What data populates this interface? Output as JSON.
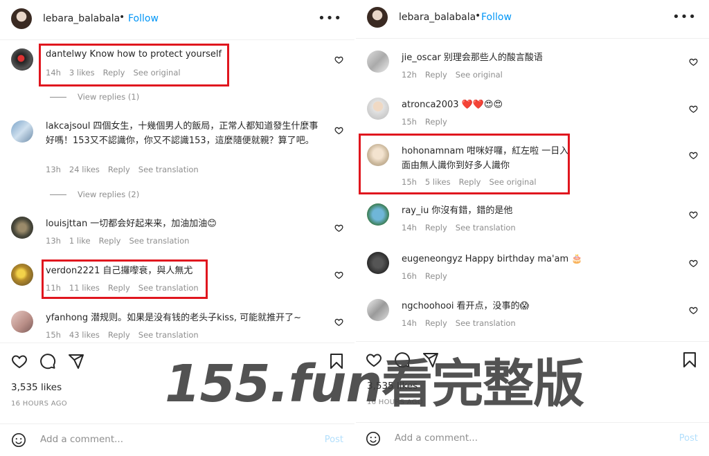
{
  "left_panel": {
    "header": {
      "username": "lebara_balabala",
      "dot": "•",
      "follow": "Follow",
      "more": "•••"
    },
    "comments": [
      {
        "username": "dantelwy",
        "text": "Know how to protect yourself",
        "time": "14h",
        "likes": "3 likes",
        "reply": "Reply",
        "link": "See original"
      },
      {
        "username": "lakcajsoul",
        "text": "四個女生，十幾個男人的飯局，正常人都知道發生什麼事好嗎！153又不認識你，你又不認識153，這麼隨便就親？算了吧。",
        "time": "13h",
        "likes": "24 likes",
        "reply": "Reply",
        "link": "See translation"
      },
      {
        "username": "louisjttan",
        "text": "一切都会好起来来，加油加油😊",
        "time": "13h",
        "likes": "1 like",
        "reply": "Reply",
        "link": "See translation"
      },
      {
        "username": "verdon2221",
        "text": "自己攞嚟衰，與人無尤",
        "time": "11h",
        "likes": "11 likes",
        "reply": "Reply",
        "link": "See translation"
      },
      {
        "username": "yfanhong",
        "text": "潜规则。如果是没有钱的老头子kiss, 可能就推开了~",
        "time": "15h",
        "likes": "43 likes",
        "reply": "Reply",
        "link": "See translation"
      }
    ],
    "view_replies": [
      "View replies (1)",
      "View replies (2)"
    ],
    "likes_count": "3,535 likes",
    "posted": "16 HOURS AGO",
    "add_comment_placeholder": "Add a comment...",
    "post_label": "Post"
  },
  "right_panel": {
    "header": {
      "username": "lebara_balabala",
      "dot": "•",
      "follow": "Follow",
      "more": "•••"
    },
    "comments": [
      {
        "username": "jie_oscar",
        "text": "别理会那些人的酸言酸语",
        "time": "12h",
        "likes": "",
        "reply": "Reply",
        "link": "See original"
      },
      {
        "username": "atronca2003",
        "text": "❤️❤️😍😍",
        "time": "15h",
        "likes": "",
        "reply": "Reply",
        "link": ""
      },
      {
        "username": "hohonamnam",
        "text": "咁咪好囉，紅左啦 一日入面由無人識你到好多人識你",
        "time": "15h",
        "likes": "5 likes",
        "reply": "Reply",
        "link": "See original"
      },
      {
        "username": "ray_iu",
        "text": "你沒有錯，錯的是他",
        "time": "14h",
        "likes": "",
        "reply": "Reply",
        "link": "See translation"
      },
      {
        "username": "eugeneongyz",
        "text": "Happy birthday ma'am 🎂",
        "time": "16h",
        "likes": "",
        "reply": "Reply",
        "link": ""
      },
      {
        "username": "ngchoohooi",
        "text": "看开点，没事的😱",
        "time": "14h",
        "likes": "",
        "reply": "Reply",
        "link": "See translation"
      }
    ],
    "likes_count": "3,535 likes",
    "posted": "16 HOURS AGO",
    "add_comment_placeholder": "Add a comment...",
    "post_label": "Post"
  },
  "watermark": {
    "brand": "155.fun",
    "suffix": "看完整版"
  },
  "colors": {
    "follow": "#0095f6",
    "meta": "#8e8e8e",
    "highlight": "#e0161e",
    "post_disabled": "#b2dffc"
  },
  "icons": [
    "heart-icon",
    "comment-icon",
    "share-icon",
    "bookmark-icon",
    "emoji-icon",
    "more-icon"
  ]
}
